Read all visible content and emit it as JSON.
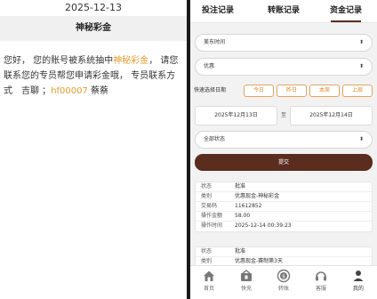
{
  "left": {
    "date": "2025-12-13",
    "title": "神秘彩金",
    "message_parts": [
      "您好， 您的账号被系统抽中",
      "神秘彩金",
      "， 请您联系您的专员帮您申请彩金哦， 专员联系方式　吉聊 ；",
      "hf00007",
      " 蔡蔡"
    ]
  },
  "tabs": [
    {
      "label": "投注记录"
    },
    {
      "label": "转账记录"
    },
    {
      "label": "资金记录"
    }
  ],
  "filters": {
    "timezone": "美东时间",
    "type": "优惠",
    "quick_label": "快速选择日期",
    "quick_buttons": [
      "今日",
      "昨日",
      "本周",
      "上周"
    ],
    "date_from": "2025年12月13日",
    "date_to_sep": "至",
    "date_to": "2025年12月14日",
    "status": "全部状态",
    "submit": "提交"
  },
  "records": [
    {
      "rows": [
        {
          "k": "状态",
          "v": "批准"
        },
        {
          "k": "类别",
          "v": "优惠现金-神秘彩金"
        },
        {
          "k": "交易码",
          "v": "11612852"
        },
        {
          "k": "操作金额",
          "v": "58.00"
        },
        {
          "k": "操作时间",
          "v": "2025-12-14 00:39:23"
        }
      ]
    },
    {
      "rows": [
        {
          "k": "状态",
          "v": "批准"
        },
        {
          "k": "类别",
          "v": "优惠现金-赛制第3天"
        }
      ]
    }
  ],
  "bottom_nav": [
    {
      "label": "首页",
      "icon": "home-icon"
    },
    {
      "label": "快充",
      "icon": "fast-charge-icon"
    },
    {
      "label": "转账",
      "icon": "transfer-icon"
    },
    {
      "label": "客服",
      "icon": "headset-icon"
    },
    {
      "label": "我的",
      "icon": "user-icon"
    }
  ],
  "colors": {
    "accent": "#5a2d1f",
    "highlight": "#e59a2e",
    "quick_border": "#e3a55c"
  }
}
